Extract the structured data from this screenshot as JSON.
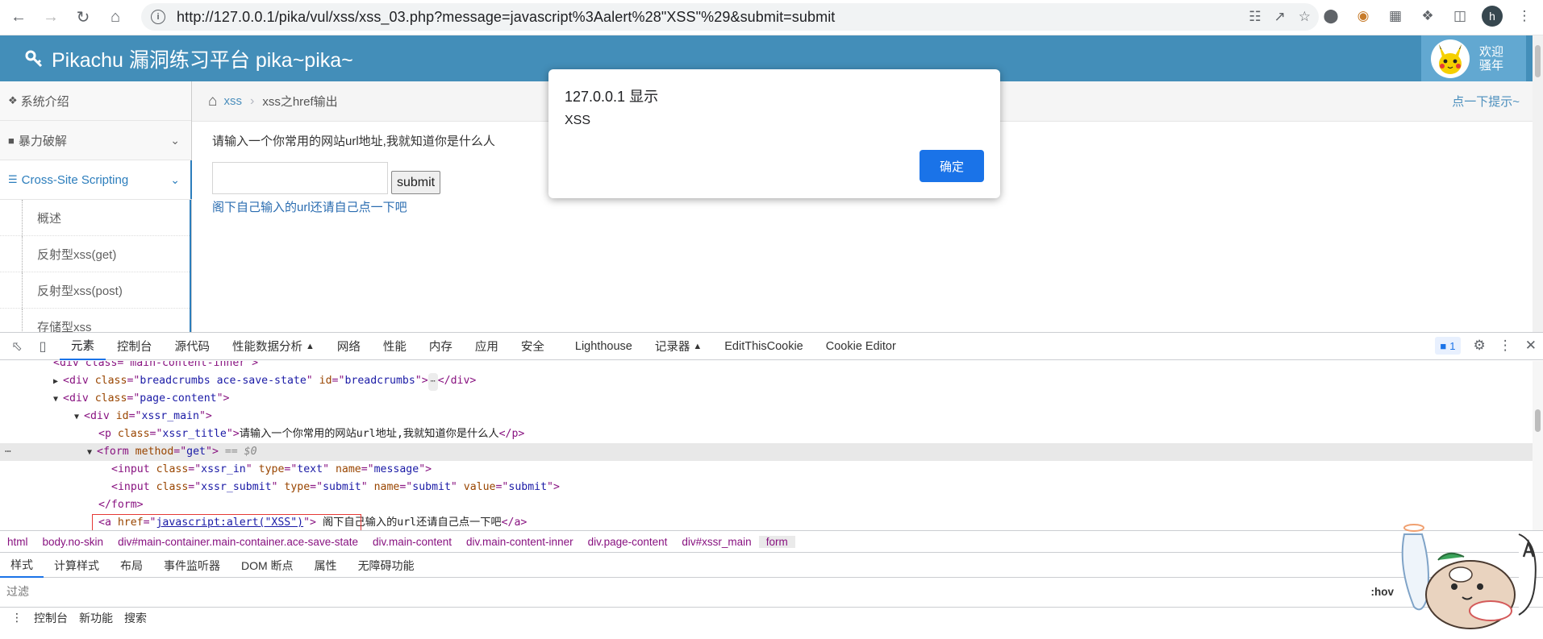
{
  "browser": {
    "url": "http://127.0.0.1/pika/vul/xss/xss_03.php?message=javascript%3Aalert%28\"XSS\"%29&submit=submit",
    "profile_initial": "h"
  },
  "app": {
    "title": "Pikachu 漏洞练习平台 pika~pika~",
    "welcome_line1": "欢迎",
    "welcome_line2": "骚年"
  },
  "sidebar": {
    "items": [
      {
        "label": "系统介绍"
      },
      {
        "label": "暴力破解"
      },
      {
        "label": "Cross-Site Scripting"
      }
    ],
    "sub_items": [
      {
        "label": "概述"
      },
      {
        "label": "反射型xss(get)"
      },
      {
        "label": "反射型xss(post)"
      },
      {
        "label": "存储型xss"
      }
    ]
  },
  "breadcrumb": {
    "link": "xss",
    "current": "xss之href输出",
    "hint": "点一下提示~"
  },
  "main": {
    "title": "请输入一个你常用的网站url地址,我就知道你是什么人",
    "input_value": "",
    "submit_label": "submit",
    "link_text": "阁下自己输入的url还请自己点一下吧"
  },
  "dialog": {
    "title": "127.0.0.1 显示",
    "message": "XSS",
    "ok_label": "确定"
  },
  "devtools": {
    "tabs": [
      "元素",
      "控制台",
      "源代码",
      "性能数据分析",
      "网络",
      "性能",
      "内存",
      "应用",
      "安全",
      "Lighthouse",
      "记录器",
      "EditThisCookie",
      "Cookie Editor"
    ],
    "issues_count": "1",
    "code": {
      "l0": "div class=\"main-content-inner\"",
      "l1_tag": "div",
      "l1_class": "breadcrumbs ace-save-state",
      "l1_id": "breadcrumbs",
      "l2_class": "page-content",
      "l3_id": "xssr_main",
      "l4_class": "xssr_title",
      "l4_text": "请输入一个你常用的网站url地址,我就知道你是什么人",
      "l5_method": "get",
      "l5_sel": "== $0",
      "l6_class": "xssr_in",
      "l6_type": "text",
      "l6_name": "message",
      "l7_class": "xssr_submit",
      "l7_type": "submit",
      "l7_name": "submit",
      "l7_value": "submit",
      "l9_href": "javascript:alert(\"XSS\")",
      "l9_text": " 阁下自己输入的url还请自己点一下吧"
    },
    "crumbs": [
      "html",
      "body.no-skin",
      "div#main-container.main-container.ace-save-state",
      "div.main-content",
      "div.main-content-inner",
      "div.page-content",
      "div#xssr_main",
      "form"
    ],
    "style_tabs": [
      "样式",
      "计算样式",
      "布局",
      "事件监听器",
      "DOM 断点",
      "属性",
      "无障碍功能"
    ],
    "filter_placeholder": "过滤",
    "hov": ":hov",
    "drawer": [
      "控制台",
      "新功能",
      "搜索"
    ]
  }
}
